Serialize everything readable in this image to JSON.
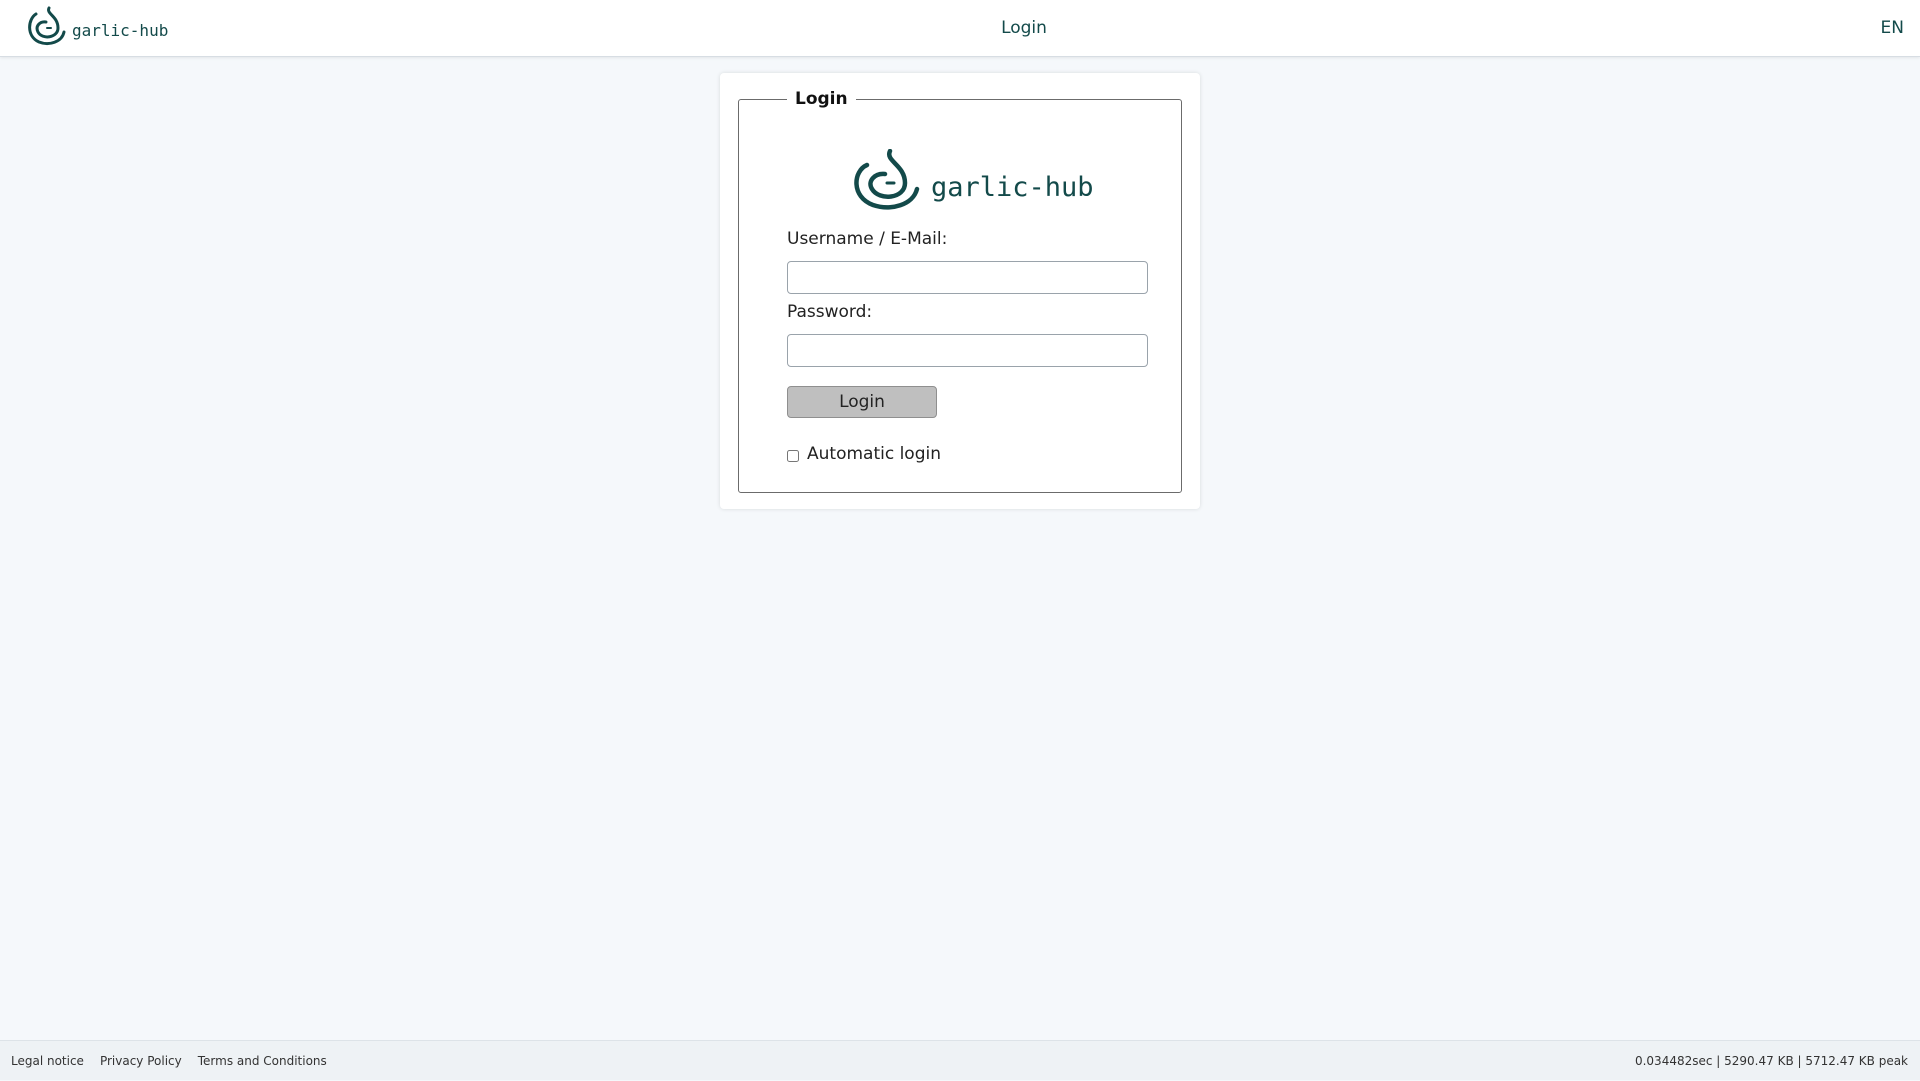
{
  "header": {
    "brand_text": "garlic-hub",
    "page_title": "Login",
    "language": "EN"
  },
  "form": {
    "legend": "Login",
    "logo_text": "garlic-hub",
    "username_label": "Username / E-Mail:",
    "username_value": "",
    "password_label": "Password:",
    "password_value": "",
    "submit_label": "Login",
    "autologin_label": "Automatic login",
    "autologin_checked": false
  },
  "footer": {
    "links": [
      "Legal notice",
      "Privacy Policy",
      "Terms and Conditions"
    ],
    "stats": "0.034482sec | 5290.47 KB | 5712.47 KB peak"
  },
  "colors": {
    "brand": "#134a4a",
    "background": "#f5f8fb",
    "button": "#bfbfbf"
  }
}
